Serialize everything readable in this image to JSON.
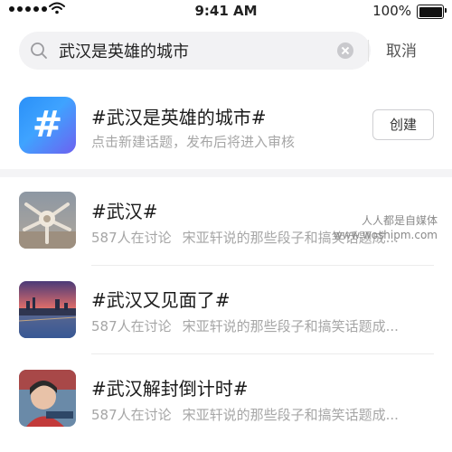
{
  "status_bar": {
    "time": "9:41 AM",
    "battery_percent": "100%",
    "signal_dots": 5,
    "battery_level": 1.0
  },
  "search": {
    "query": "武汉是英雄的城市",
    "cancel_label": "取消"
  },
  "new_topic": {
    "title": "#武汉是英雄的城市#",
    "subtitle": "点击新建话题，发布后将进入审核",
    "create_label": "创建",
    "badge_symbol": "#",
    "badge_colors": [
      "#2a90f8",
      "#6d61f0"
    ]
  },
  "results": [
    {
      "title": "#武汉#",
      "count": "587人在讨论",
      "snippet": "宋亚轩说的那些段子和搞笑话题成..."
    },
    {
      "title": "#武汉又见面了#",
      "count": "587人在讨论",
      "snippet": "宋亚轩说的那些段子和搞笑话题成..."
    },
    {
      "title": "#武汉解封倒计时#",
      "count": "587人在讨论",
      "snippet": "宋亚轩说的那些段子和搞笑话题成..."
    }
  ],
  "watermark": {
    "line1": "人人都是自媒体",
    "line2": "www.woshipm.com"
  },
  "colors": {
    "accent_gradient_start": "#2a90f8",
    "accent_gradient_end": "#6d61f0",
    "muted_text": "#a6a6a6",
    "primary_text": "#1a1a1a"
  }
}
